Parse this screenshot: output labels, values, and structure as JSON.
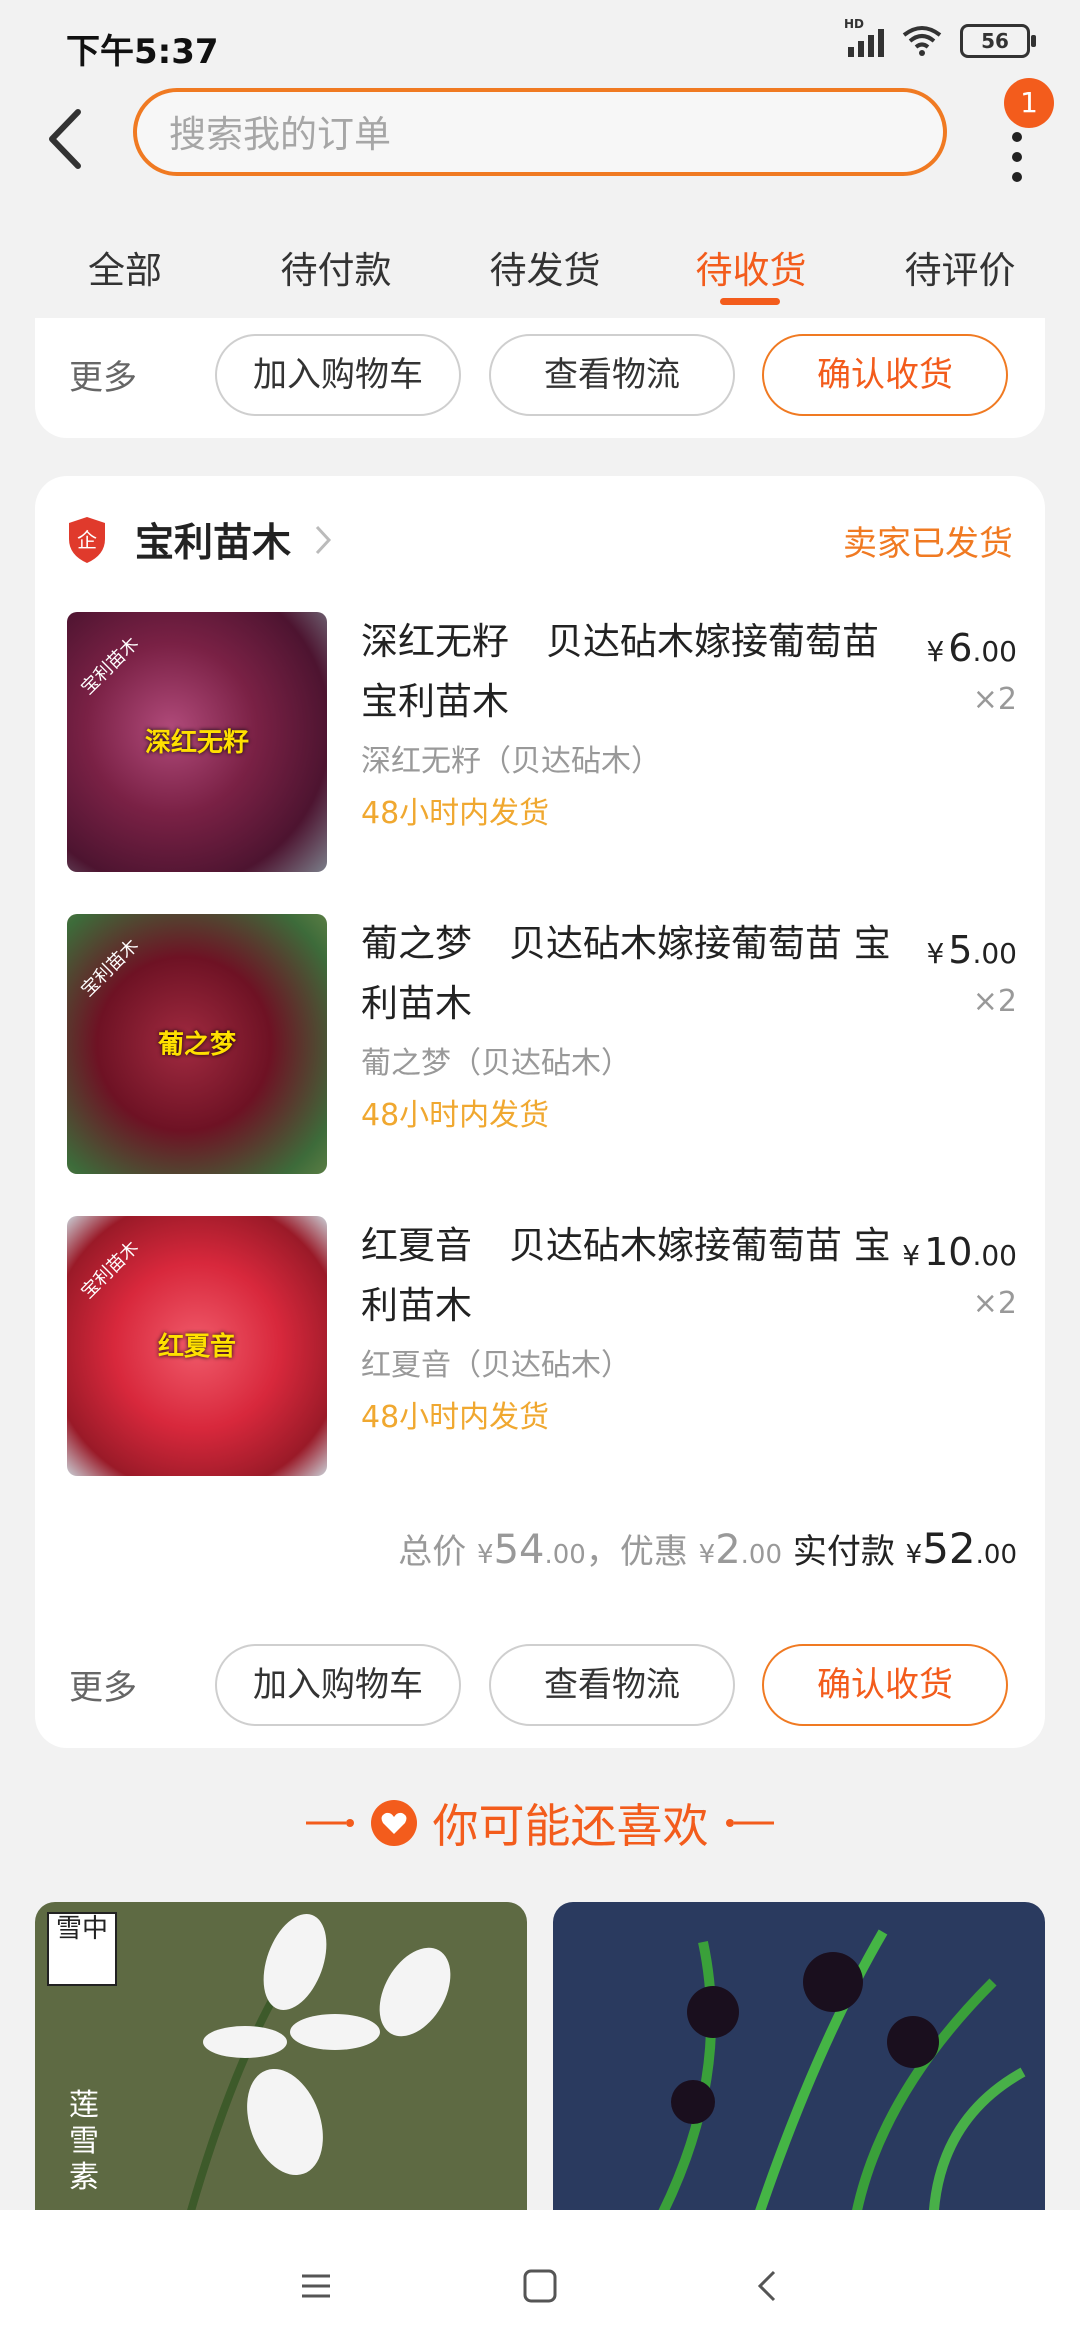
{
  "status_bar": {
    "time": "下午5:37",
    "signal_label": "HD",
    "battery": "56"
  },
  "header": {
    "search_placeholder": "搜索我的订单",
    "notification_count": "1"
  },
  "tabs": [
    {
      "label": "全部"
    },
    {
      "label": "待付款"
    },
    {
      "label": "待发货"
    },
    {
      "label": "待收货",
      "active": true
    },
    {
      "label": "待评价"
    }
  ],
  "order_actions": {
    "more": "更多",
    "add_cart": "加入购物车",
    "view_logistics": "查看物流",
    "confirm_receipt": "确认收货"
  },
  "order": {
    "store_name": "宝利苗木",
    "status": "卖家已发货",
    "items": [
      {
        "title": "深红无籽　贝达砧木嫁接葡萄苗 宝利苗木",
        "spec": "深红无籽（贝达砧木）",
        "shipping": "48小时内发货",
        "price_int": "6",
        "price_dec": ".00",
        "qty": "×2",
        "image_label": "深红无籽",
        "image_corner": "宝利苗木"
      },
      {
        "title": "葡之梦　贝达砧木嫁接葡萄苗 宝利苗木",
        "spec": "葡之梦（贝达砧木）",
        "shipping": "48小时内发货",
        "price_int": "5",
        "price_dec": ".00",
        "qty": "×2",
        "image_label": "葡之梦",
        "image_corner": "宝利苗木"
      },
      {
        "title": "红夏音　贝达砧木嫁接葡萄苗 宝利苗木",
        "spec": "红夏音（贝达砧木）",
        "shipping": "48小时内发货",
        "price_int": "10",
        "price_dec": ".00",
        "qty": "×2",
        "image_label": "红夏音",
        "image_corner": "宝利苗木"
      }
    ],
    "summary": {
      "total_label": "总价",
      "total_int": "54",
      "total_dec": ".00",
      "discount_label": "，优惠",
      "discount_int": "2",
      "discount_dec": ".00",
      "paid_label": "实付款",
      "paid_int": "52",
      "paid_dec": ".00"
    }
  },
  "recommend": {
    "title": "你可能还喜欢",
    "left_card_text": "莲雪素",
    "left_logo": "雪中"
  },
  "colors": {
    "accent": "#f35c1c",
    "accent_border": "#f07a22",
    "shipping": "#f0a830"
  }
}
